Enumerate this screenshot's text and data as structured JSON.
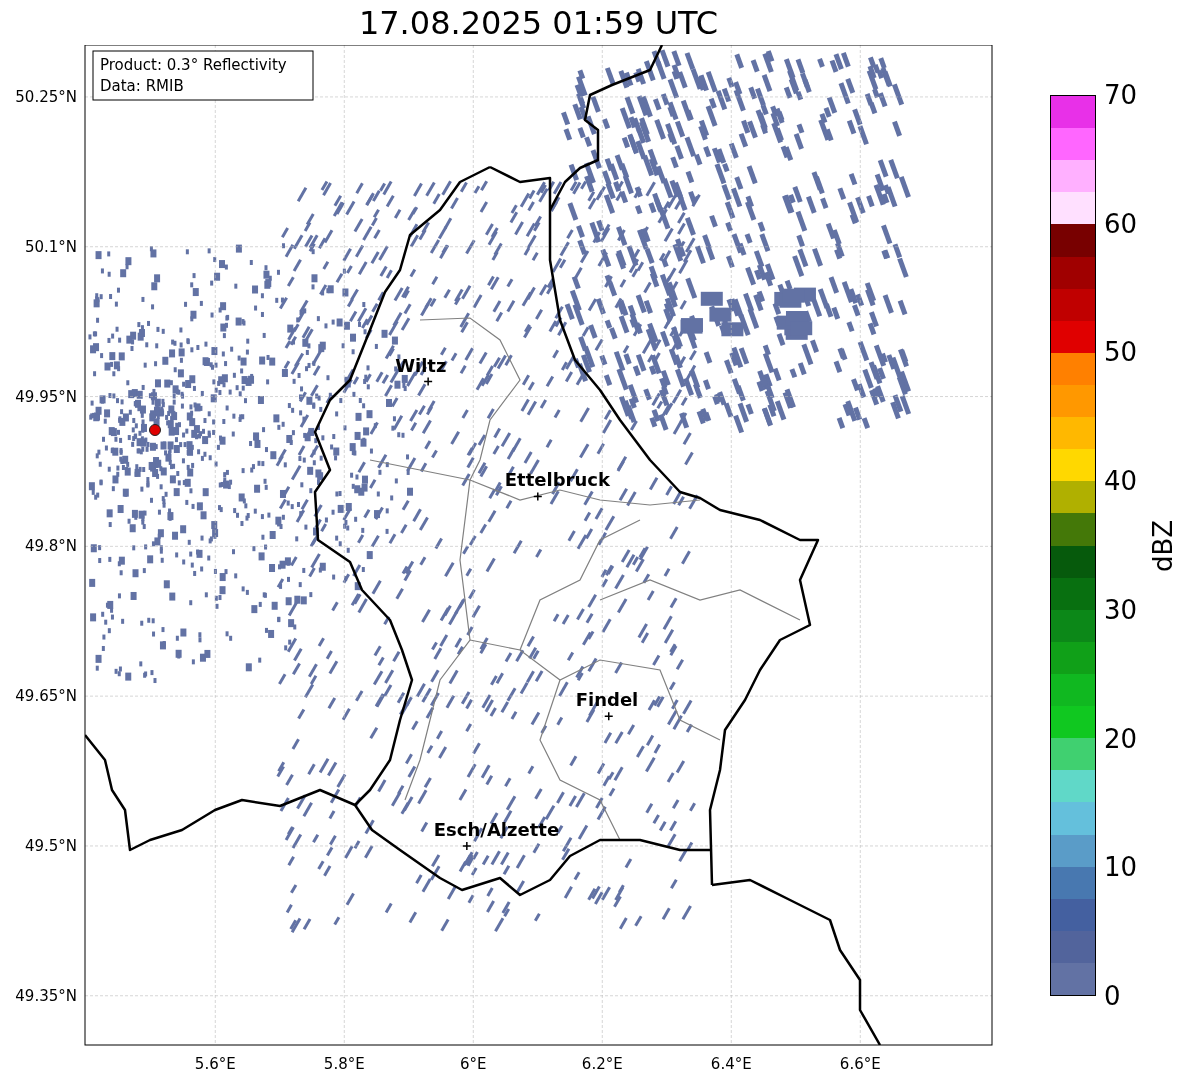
{
  "title": "17.08.2025 01:59 UTC",
  "info_box": {
    "lines": [
      "Product: 0.3° Reflectivity",
      "Data: RMIB"
    ]
  },
  "map": {
    "lat_ticks": [
      "50.25°N",
      "50.1°N",
      "49.95°N",
      "49.8°N",
      "49.65°N",
      "49.5°N",
      "49.35°N"
    ],
    "lon_ticks": [
      "5.6°E",
      "5.8°E",
      "6°E",
      "6.2°E",
      "6.4°E",
      "6.6°E"
    ],
    "cities": [
      {
        "name": "Wiltz"
      },
      {
        "name": "Ettelbruck"
      },
      {
        "name": "Findel"
      },
      {
        "name": "Esch/Alzette"
      }
    ]
  },
  "colorbar": {
    "label": "dBZ",
    "ticks": [
      "70",
      "60",
      "50",
      "40",
      "30",
      "20",
      "10",
      "0"
    ],
    "bands": [
      {
        "color": "#e830e8"
      },
      {
        "color": "#ff66ff"
      },
      {
        "color": "#ffb0ff"
      },
      {
        "color": "#ffe0ff"
      },
      {
        "color": "#780000"
      },
      {
        "color": "#a00000"
      },
      {
        "color": "#c00000"
      },
      {
        "color": "#e00000"
      },
      {
        "color": "#ff8000"
      },
      {
        "color": "#ff9800"
      },
      {
        "color": "#ffb800"
      },
      {
        "color": "#ffd800"
      },
      {
        "color": "#b0b000"
      },
      {
        "color": "#447808"
      },
      {
        "color": "#065a0c"
      },
      {
        "color": "#087010"
      },
      {
        "color": "#0c8818"
      },
      {
        "color": "#10a018"
      },
      {
        "color": "#10b820"
      },
      {
        "color": "#10c820"
      },
      {
        "color": "#40d070"
      },
      {
        "color": "#60d8c8"
      },
      {
        "color": "#64c0dc"
      },
      {
        "color": "#5a9cc8"
      },
      {
        "color": "#4878b0"
      },
      {
        "color": "#4460a0"
      },
      {
        "color": "#52649c"
      },
      {
        "color": "#6272a4"
      }
    ]
  }
}
